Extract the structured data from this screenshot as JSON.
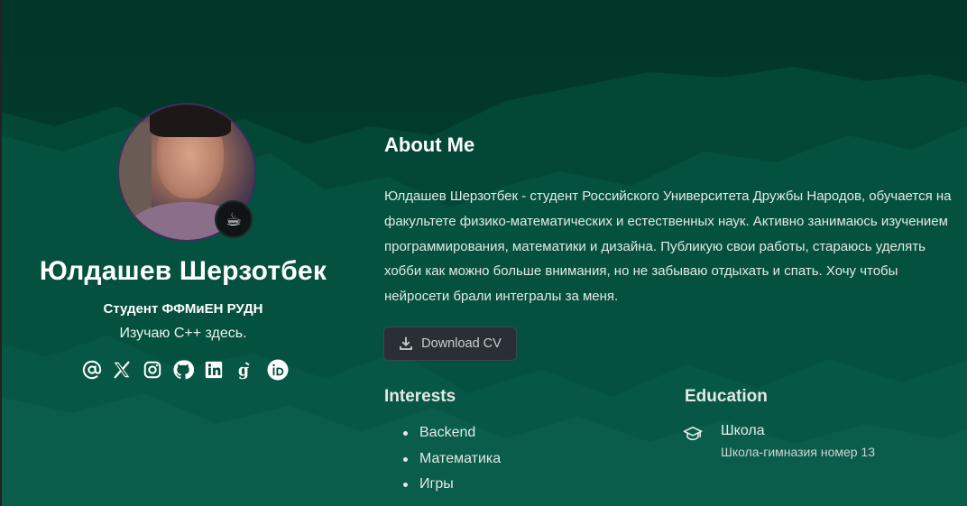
{
  "colors": {
    "background_top": "#013a2c",
    "background_bottom": "#0a5a4b",
    "text_primary": "#ffffff",
    "button_background": "#2a2f36"
  },
  "profile": {
    "name": "Юлдашев Шерзотбек",
    "role": "Студент ФФМиЕН РУДН",
    "tagline": "Изучаю C++ здесь.",
    "status_emoji": "☕",
    "social_icons": [
      "at-icon",
      "x-icon",
      "instagram-icon",
      "github-icon",
      "linkedin-icon",
      "google-scholar-icon",
      "orcid-icon"
    ]
  },
  "about": {
    "title": "About Me",
    "text": "Юлдашев Шерзотбек - студент Российского Университета Дружбы Народов, обучается на факультете физико-математических и естественных наук. Активно занимаюсь изучением программирования, математики и дизайна. Публикую свои работы, стараюсь уделять хобби как можно больше внимания, но не забываю отдыхать и спать. Хочу чтобы нейросети брали интегралы за меня.",
    "cv_button_label": "Download CV",
    "cv_button_icon": "download-icon"
  },
  "interests": {
    "title": "Interests",
    "items": [
      "Backend",
      "Математика",
      "Игры"
    ]
  },
  "education": {
    "title": "Education",
    "icon": "graduation-cap-icon",
    "items": [
      {
        "school": "Школа",
        "detail": "Школа-гимназия номер 13"
      }
    ]
  }
}
